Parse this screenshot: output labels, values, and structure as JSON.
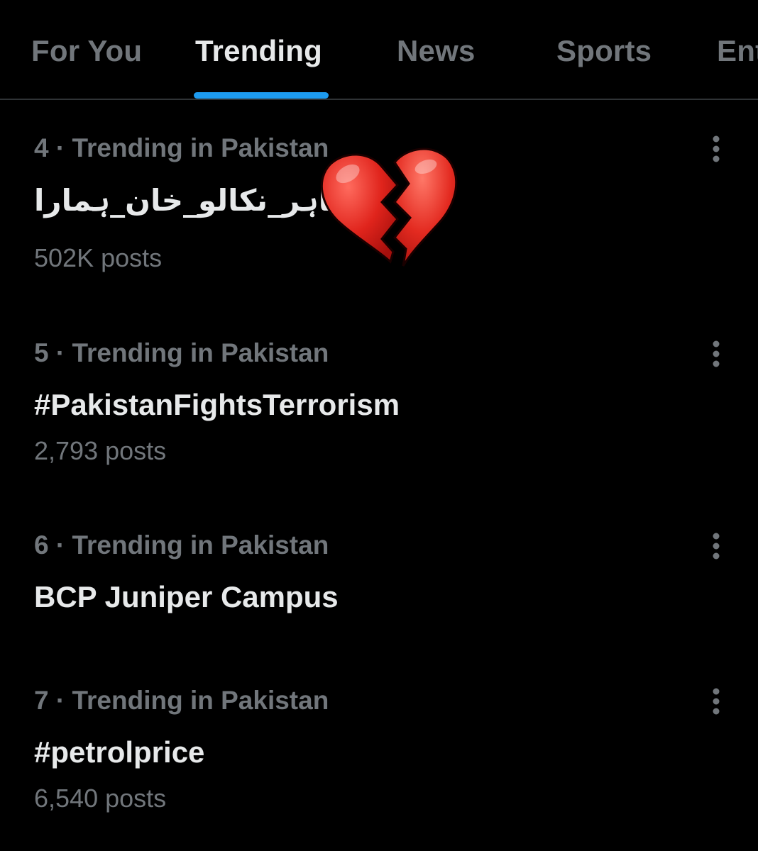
{
  "tabs": [
    {
      "label": "For You",
      "active": false
    },
    {
      "label": "Trending",
      "active": true
    },
    {
      "label": "News",
      "active": false
    },
    {
      "label": "Sports",
      "active": false
    },
    {
      "label": "Ent",
      "active": false
    }
  ],
  "trends": [
    {
      "meta": "4 · Trending in Pakistan",
      "topic": "#باہر_نکالو_خان_ہمارا",
      "posts": "502K posts"
    },
    {
      "meta": "5 · Trending in Pakistan",
      "topic": "#PakistanFightsTerrorism",
      "posts": "2,793 posts"
    },
    {
      "meta": "6 · Trending in Pakistan",
      "topic": "BCP Juniper Campus",
      "posts": ""
    },
    {
      "meta": "7 · Trending in Pakistan",
      "topic": "#petrolprice",
      "posts": "6,540 posts"
    }
  ],
  "icons": {
    "more": "more-vertical-icon",
    "emoji": "broken-heart-icon"
  },
  "colors": {
    "background": "#000000",
    "text_primary": "#e7e9ea",
    "text_secondary": "#71767b",
    "accent": "#1d9bf0",
    "divider": "#2f3336"
  }
}
